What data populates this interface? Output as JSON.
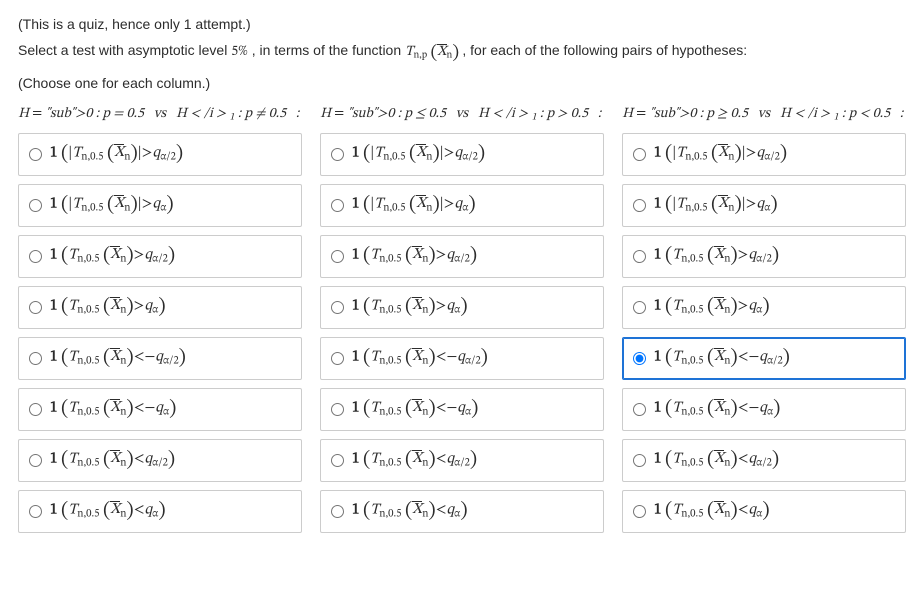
{
  "intro": {
    "note": "(This is a quiz, hence only 1 attempt.)",
    "prompt_pre": "Select a test with asymptotic level ",
    "prompt_level": "5%",
    "prompt_mid": " , in terms of the function ",
    "prompt_func": "T",
    "prompt_func_sub": "n,p",
    "prompt_arg_open": " (",
    "prompt_arg_X": "X",
    "prompt_arg_Xsub": "n",
    "prompt_arg_close": ") , ",
    "prompt_post": " for each of the following pairs of hypotheses:",
    "choose": "(Choose one for each column.)"
  },
  "columns": [
    {
      "id": "c1",
      "header_h0": "H₀ : p = 0.5",
      "header_vs": "vs",
      "header_h1": "H₁ : p ≠ 0.5",
      "selected": null
    },
    {
      "id": "c2",
      "header_h0": "H₀ : p ≤ 0.5",
      "header_vs": "vs",
      "header_h1": "H₁ : p > 0.5",
      "selected": null
    },
    {
      "id": "c3",
      "header_h0": "H₀ : p ≥ 0.5",
      "header_vs": "vs",
      "header_h1": "H₁ : p < 0.5",
      "selected": 4
    }
  ],
  "option_templates": [
    {
      "abs": true,
      "op": ">",
      "q": "q",
      "qsub": "α/2"
    },
    {
      "abs": true,
      "op": ">",
      "q": "q",
      "qsub": "α"
    },
    {
      "abs": false,
      "op": ">",
      "q": "q",
      "qsub": "α/2"
    },
    {
      "abs": false,
      "op": ">",
      "q": "q",
      "qsub": "α"
    },
    {
      "abs": false,
      "op": "<−",
      "q": "q",
      "qsub": "α/2"
    },
    {
      "abs": false,
      "op": "<−",
      "q": "q",
      "qsub": "α"
    },
    {
      "abs": false,
      "op": "<",
      "q": "q",
      "qsub": "α/2"
    },
    {
      "abs": false,
      "op": "<",
      "q": "q",
      "qsub": "α"
    }
  ],
  "shared": {
    "one": "1",
    "T": "T",
    "Tsub": "n,0.5",
    "X": "X",
    "Xsub": "n"
  }
}
